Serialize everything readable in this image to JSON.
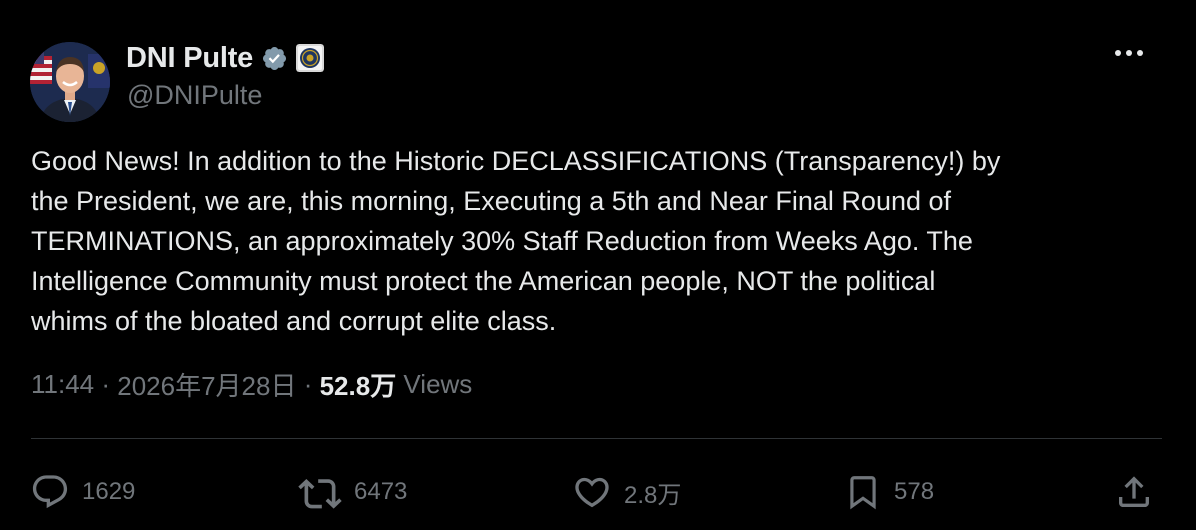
{
  "author": {
    "display_name": "DNI Pulte",
    "handle": "@DNIPulte",
    "verified_badge_icon": "verified-check-icon",
    "affiliation_badge_icon": "government-seal-icon"
  },
  "post": {
    "text": "Good News! In addition to the Historic DECLASSIFICATIONS (Transparency!) by\nthe President, we are, this morning, Executing a 5th and Near Final Round of\nTERMINATIONS, an approximately 30% Staff Reduction from Weeks Ago. The\nIntelligence Community must protect the American people, NOT the political\nwhims of the bloated and corrupt elite class."
  },
  "meta": {
    "time": "11:44",
    "separator": " · ",
    "date": "2026年7月28日",
    "views_count": "52.8万",
    "views_label": " Views"
  },
  "actions": {
    "replies": "1629",
    "reposts": "6473",
    "likes": "2.8万",
    "bookmarks": "578"
  },
  "icons": {
    "more": "more-horizontal-icon",
    "reply": "reply-icon",
    "repost": "repost-icon",
    "like": "heart-icon",
    "bookmark": "bookmark-icon",
    "share": "share-icon"
  },
  "colors": {
    "background": "#000000",
    "text_primary": "#e7e9ea",
    "text_secondary": "#71767b",
    "divider": "#2f3336",
    "verified": "#829aab"
  }
}
